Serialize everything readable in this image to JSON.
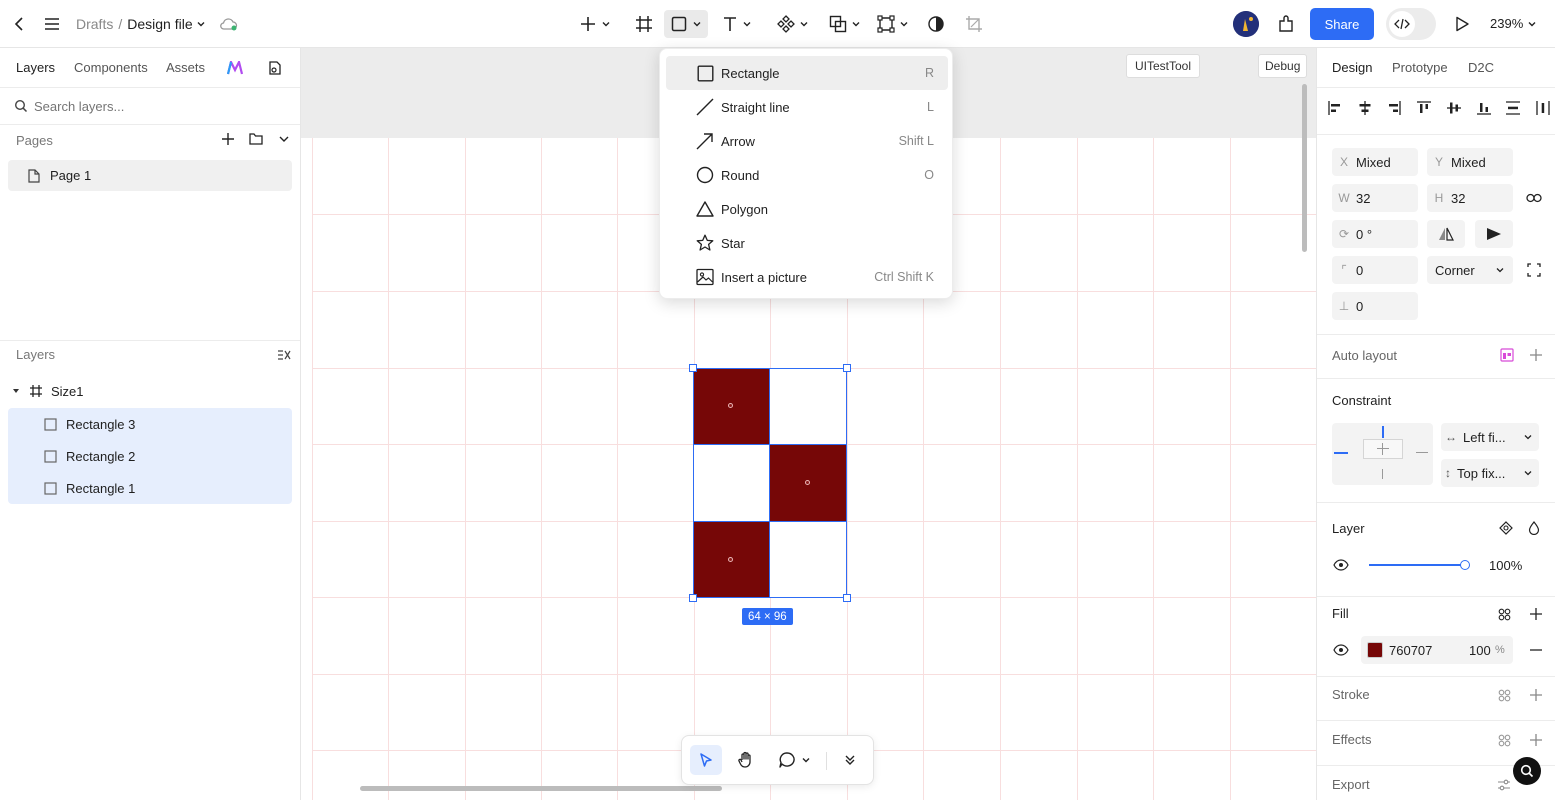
{
  "topbar": {
    "breadcrumb_root": "Drafts",
    "breadcrumb_sep": "/",
    "file_name": "Design file",
    "share_label": "Share",
    "zoom": "239%"
  },
  "left_panel": {
    "tabs": [
      "Layers",
      "Components",
      "Assets"
    ],
    "search_placeholder": "Search layers...",
    "pages_title": "Pages",
    "pages": [
      {
        "label": "Page 1"
      }
    ],
    "layers_title": "Layers",
    "layers": [
      {
        "label": "Size1"
      },
      {
        "label": "Rectangle 3"
      },
      {
        "label": "Rectangle 2"
      },
      {
        "label": "Rectangle 1"
      }
    ]
  },
  "canvas": {
    "tool_labels": [
      "UITestTool",
      "Debug"
    ],
    "size_badge": "64 × 96",
    "fill_color": "#760707",
    "selection_color": "#2d6cf5"
  },
  "shape_menu": {
    "items": [
      {
        "label": "Rectangle",
        "shortcut": "R",
        "icon": "rectangle-icon"
      },
      {
        "label": "Straight line",
        "shortcut": "L",
        "icon": "line-icon"
      },
      {
        "label": "Arrow",
        "shortcut": "Shift L",
        "icon": "arrow-icon"
      },
      {
        "label": "Round",
        "shortcut": "O",
        "icon": "circle-icon"
      },
      {
        "label": "Polygon",
        "shortcut": "",
        "icon": "triangle-icon"
      },
      {
        "label": "Star",
        "shortcut": "",
        "icon": "star-icon"
      },
      {
        "label": "Insert a picture",
        "shortcut": "Ctrl Shift K",
        "icon": "image-icon"
      }
    ]
  },
  "right_panel": {
    "tabs": [
      "Design",
      "Prototype",
      "D2C"
    ],
    "x_label": "X",
    "x_value": "Mixed",
    "y_label": "Y",
    "y_value": "Mixed",
    "w_label": "W",
    "w_value": "32",
    "h_label": "H",
    "h_value": "32",
    "rotation": "0 °",
    "radius": "0",
    "corner_mode": "Corner",
    "spacing": "0",
    "auto_layout": "Auto layout",
    "constraint": "Constraint",
    "constraint_h": "Left fi...",
    "constraint_v": "Top fix...",
    "layer_title": "Layer",
    "opacity": "100%",
    "opacity_level": 1.0,
    "fill_title": "Fill",
    "fill_hex": "760707",
    "fill_opacity": "100",
    "fill_pct": "%",
    "stroke": "Stroke",
    "effects": "Effects",
    "export": "Export"
  }
}
